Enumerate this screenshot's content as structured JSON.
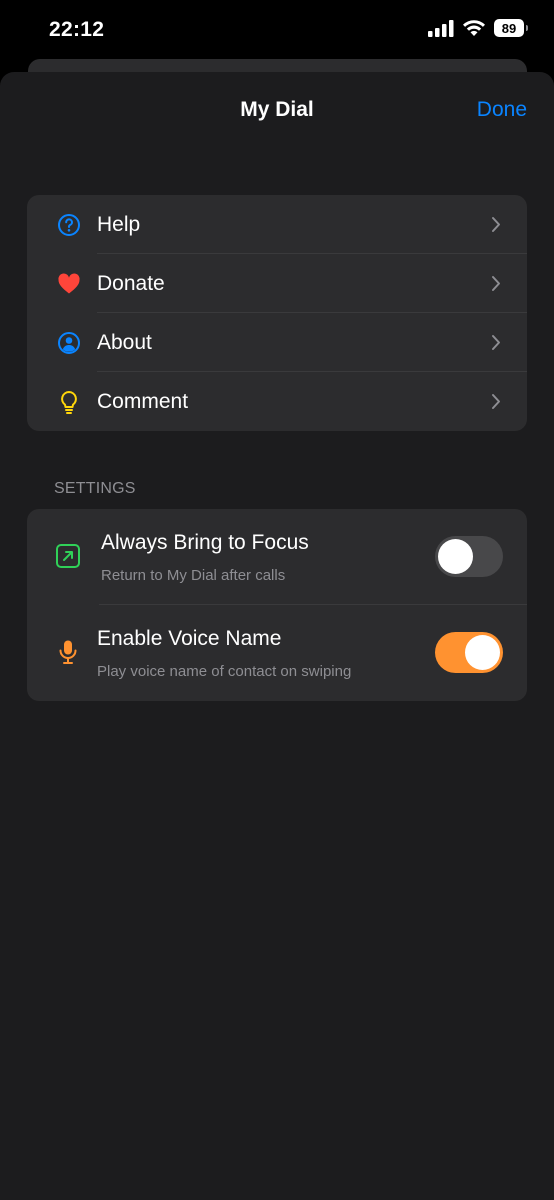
{
  "status_bar": {
    "time": "22:12",
    "battery": "89"
  },
  "nav": {
    "title": "My Dial",
    "done_label": "Done"
  },
  "menu": {
    "items": [
      {
        "label": "Help",
        "icon": "question-circle-icon",
        "color": "#0a84ff"
      },
      {
        "label": "Donate",
        "icon": "heart-icon",
        "color": "#ff453a"
      },
      {
        "label": "About",
        "icon": "person-circle-icon",
        "color": "#0a84ff"
      },
      {
        "label": "Comment",
        "icon": "lightbulb-icon",
        "color": "#ffd60a"
      }
    ]
  },
  "settings": {
    "header": "SETTINGS",
    "items": [
      {
        "title": "Always Bring to Focus",
        "subtitle": "Return to My Dial after calls",
        "icon": "arrow-square-icon",
        "color": "#30d158",
        "enabled": false
      },
      {
        "title": "Enable Voice Name",
        "subtitle": "Play voice name of contact on swiping",
        "icon": "microphone-icon",
        "color": "#ff9230",
        "enabled": true
      }
    ]
  },
  "colors": {
    "accent": "#0a84ff",
    "toggle_on": "#ff9230",
    "background": "#1c1c1e",
    "group": "#2c2c2e"
  }
}
